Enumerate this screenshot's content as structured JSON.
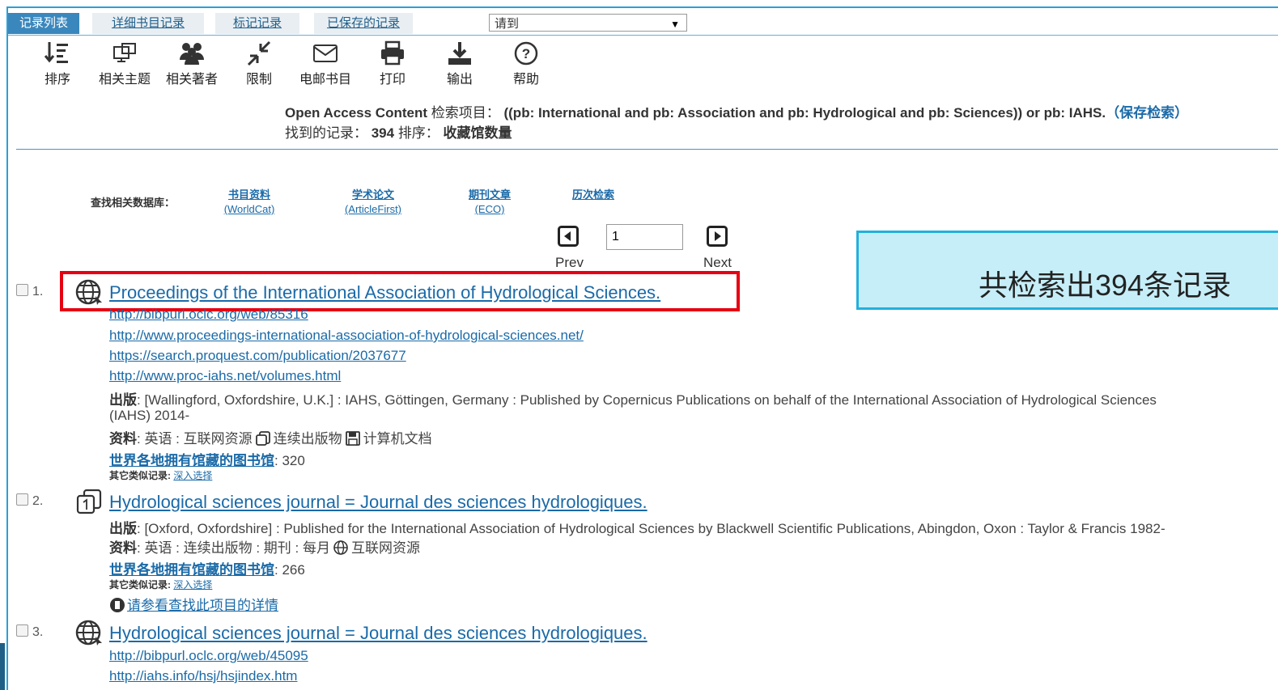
{
  "tabs": [
    {
      "label": "记录列表"
    },
    {
      "label": "详细书目记录"
    },
    {
      "label": "标记记录"
    },
    {
      "label": "已保存的记录"
    }
  ],
  "goto_select": {
    "value": "请到"
  },
  "toolbar": [
    {
      "label": "排序",
      "icon": "sort-icon"
    },
    {
      "label": "相关主题",
      "icon": "subjects-icon"
    },
    {
      "label": "相关著者",
      "icon": "authors-icon"
    },
    {
      "label": "限制",
      "icon": "limit-icon"
    },
    {
      "label": "电邮书目",
      "icon": "email-icon"
    },
    {
      "label": "打印",
      "icon": "print-icon"
    },
    {
      "label": "输出",
      "icon": "export-icon"
    },
    {
      "label": "帮助",
      "icon": "help-icon"
    }
  ],
  "search_info": {
    "prefix_bold": "Open Access Content",
    "label": " 检索项目：",
    "query": " ((pb: International and pb: Association and pb: Hydrological and pb: Sciences)) or pb: IAHS.",
    "save_link": "（保存检索）",
    "found_label": "找到的记录：",
    "count": " 394 ",
    "sort_label": "排序：",
    "sort_value": " 收藏馆数量"
  },
  "related_db": {
    "label": "查找相关数据库：",
    "items": [
      {
        "title": "书目资料",
        "sub": "(WorldCat)"
      },
      {
        "title": "学术论文",
        "sub": "(ArticleFirst)"
      },
      {
        "title": "期刊文章",
        "sub": "(ECO)"
      },
      {
        "title": "历次检索",
        "sub": ""
      }
    ]
  },
  "pager": {
    "prev": "Prev",
    "next": "Next",
    "page": "1"
  },
  "callout": "共检索出394条记录",
  "records": [
    {
      "num": "1.",
      "title": "Proceedings of the International Association of Hydrological Sciences.",
      "links": [
        "http://bibpurl.oclc.org/web/85316",
        "http://www.proceedings-international-association-of-hydrological-sciences.net/",
        "https://search.proquest.com/publication/2037677",
        "http://www.proc-iahs.net/volumes.html"
      ],
      "pub_label": "出版",
      "pub_line1": ": [Wallingford, Oxfordshire, U.K.] : IAHS, Göttingen, Germany : Published by Copernicus Publications on behalf of the International Association of Hydrological Sciences",
      "pub_line2": "(IAHS) 2014-",
      "res_label": "资料",
      "res_text1": ": 英语 : 互联网资源",
      "res_text2": "连续出版物",
      "res_text3": "计算机文档",
      "lib_label": "世界各地拥有馆藏的图书馆",
      "lib_count": ": 320",
      "sim_label": "其它类似记录: ",
      "sim_link": "深入选择"
    },
    {
      "num": "2.",
      "title": "Hydrological sciences journal = Journal des sciences hydrologiques.",
      "pub_label": "出版",
      "pub_line1": ": [Oxford, Oxfordshire] : Published for the International Association of Hydrological Sciences by Blackwell Scientific Publications, Abingdon, Oxon : Taylor & Francis 1982-",
      "res_label": "资料",
      "res_text1": ": 英语 : 连续出版物 : 期刊 : 每月",
      "res_text2": "互联网资源",
      "lib_label": "世界各地拥有馆藏的图书馆",
      "lib_count": ": 266",
      "sim_label": "其它类似记录: ",
      "sim_link": "深入选择",
      "detail_link": "请参看查找此项目的详情"
    },
    {
      "num": "3.",
      "title": "Hydrological sciences journal = Journal des sciences hydrologiques.",
      "links": [
        "http://bibpurl.oclc.org/web/45095",
        "http://iahs.info/hsj/hsjindex.htm"
      ]
    }
  ]
}
